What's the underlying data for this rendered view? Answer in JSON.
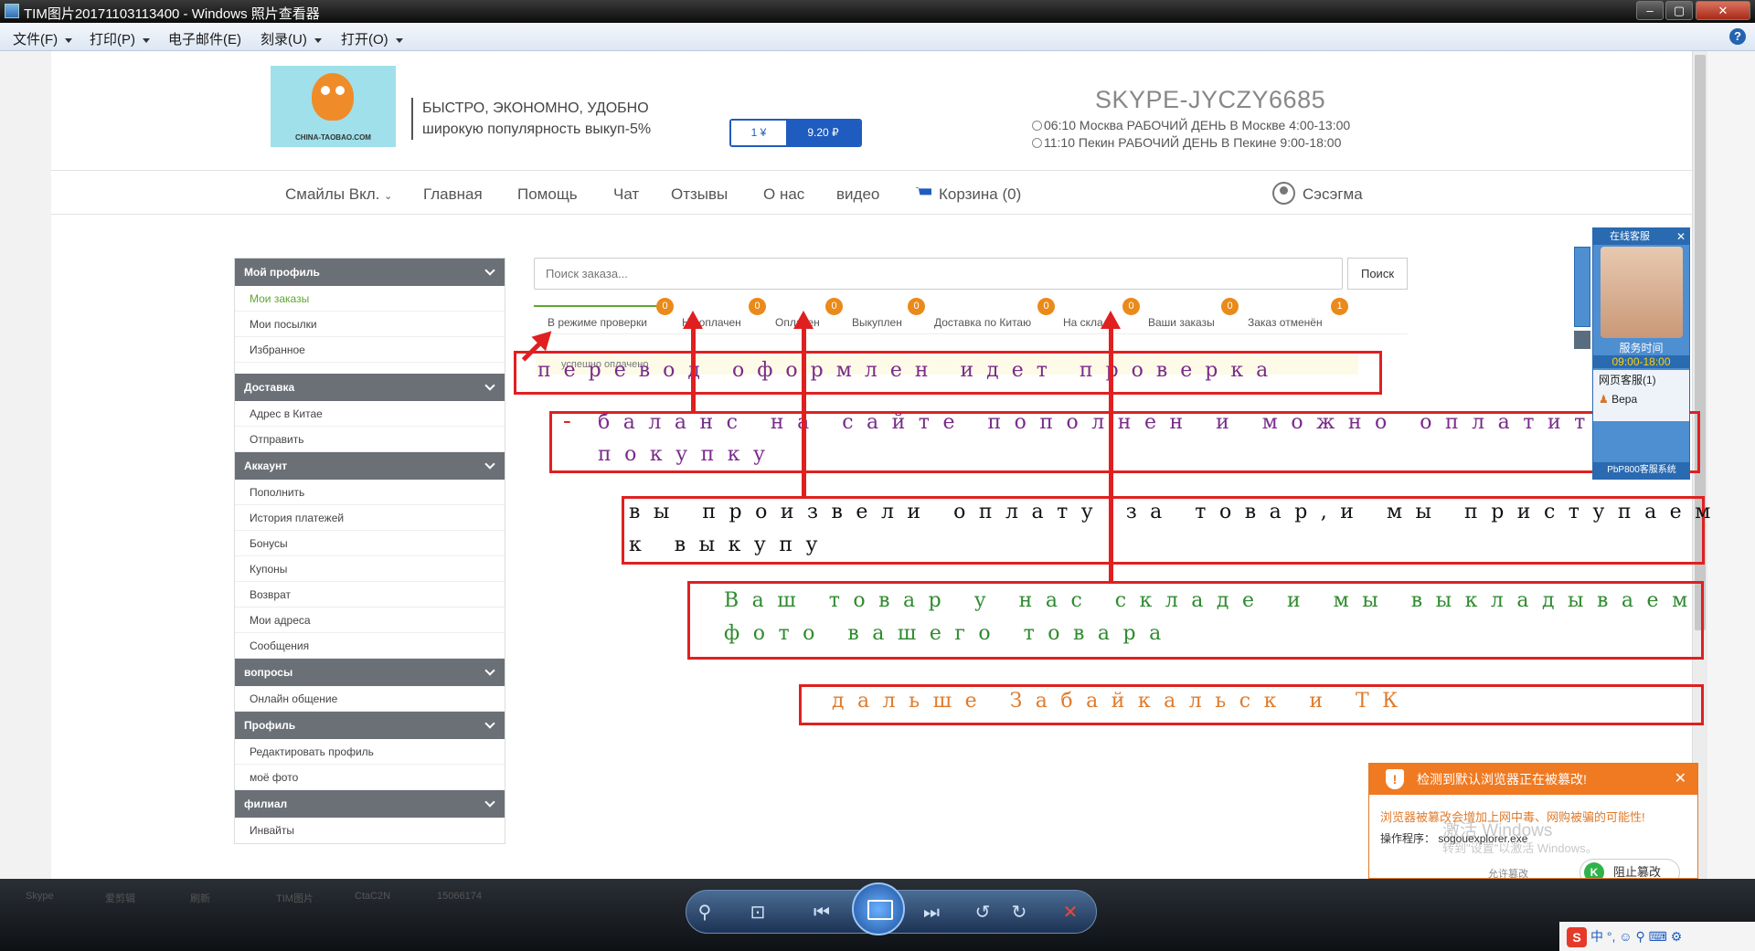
{
  "window": {
    "title": "TIM图片20171103113400 - Windows 照片查看器",
    "menu": [
      "文件(F)",
      "打印(P)",
      "电子邮件(E)",
      "刻录(U)",
      "打开(O)"
    ],
    "help": "?"
  },
  "header": {
    "logo_text": "CHINA-TAOBAO.COM",
    "slogan_line1": "БЫСТРО, ЭКОНОМНО, УДОБНО",
    "slogan_line2": "широкую популярность выкуп-5%",
    "rate_left": "1 ¥",
    "rate_right": "9.20 ₽",
    "skype": "SKYPE-JYCZY6685",
    "moscow_line": "06:10  Москва  РАБОЧИЙ ДЕНЬ В Москве 4:00-13:00",
    "beijing_line": "11:10  Пекин   РАБОЧИЙ ДЕНЬ В Пекине 9:00-18:00"
  },
  "nav": {
    "items": [
      "Смайлы Вкл.",
      "Главная",
      "Помощь",
      "Чат",
      "Отзывы",
      "О нас",
      "видео"
    ],
    "cart": "Корзина (0)",
    "user": "Сэсэгма"
  },
  "sidebar": {
    "sections": [
      {
        "title": "Мой профиль",
        "items": [
          "Мои заказы",
          "Мои посылки",
          "Избранное"
        ]
      },
      {
        "title": "Доставка",
        "items": [
          "Адрес в Китае",
          "Отправить"
        ]
      },
      {
        "title": "Аккаунт",
        "items": [
          "Пополнить",
          "История платежей",
          "Бонусы",
          "Купоны",
          "Возврат",
          "Мои адреса",
          "Сообщения"
        ]
      },
      {
        "title": "вопросы",
        "items": [
          "Онлайн общение"
        ]
      },
      {
        "title": "Профиль",
        "items": [
          "Редактировать профиль",
          "моё фото"
        ]
      },
      {
        "title": "филиал",
        "items": [
          "Инвайты"
        ]
      }
    ]
  },
  "orders": {
    "search_placeholder": "Поиск заказа...",
    "search_button": "Поиск",
    "tabs": [
      {
        "label": "В режиме проверки",
        "count": "0"
      },
      {
        "label": "Не оплачен",
        "count": "0"
      },
      {
        "label": "Оплачен",
        "count": "0"
      },
      {
        "label": "Выкуплен",
        "count": "0"
      },
      {
        "label": "Доставка по Китаю",
        "count": "0"
      },
      {
        "label": "На складе",
        "count": "0"
      },
      {
        "label": "Ваши заказы",
        "count": "0"
      },
      {
        "label": "Заказ отменён",
        "count": "1"
      }
    ],
    "notice": "успешно оплачено"
  },
  "annotations": {
    "a1": "перевод оформлен идет проверка",
    "a2_line1": "баланс на сайте пополнен и можно оплатить",
    "a2_line2": "покупку",
    "a3_line1": "вы произвели оплату за товар,и мы приступаем",
    "a3_line2": "к выкупу",
    "a4_line1": "Ваш товар у нас складе и мы выкладываем",
    "a4_line2": "фото вашего товара",
    "a5": "дальше Забайкальск и ТК",
    "colors": {
      "box": "#e02020",
      "purple": "#7a2a8a",
      "black": "#111111",
      "green": "#2e8b2e",
      "orange": "#e07a2a"
    }
  },
  "chat_widget": {
    "title": "在线客服",
    "service_time_label": "服务时间",
    "hours": "09:00-18:00",
    "group": "网页客服(1)",
    "agent": "Вера",
    "footer": "PbP800客服系统"
  },
  "warning": {
    "title": "检测到默认浏览器正在被篡改!",
    "line1": "浏览器被篡改会增加上网中毒、网购被骗的可能性!",
    "program": "操作程序： sogouexplorer.exe",
    "watermark1": "激活 Windows",
    "watermark2": "转到\"设置\"以激活 Windows。",
    "skip": "允许篡改",
    "button": "阻止篡改"
  },
  "taskbar": {
    "items": [
      "Skype",
      "爱剪辑",
      "刷新",
      "TIM图片",
      "CtaC2N",
      "15066174"
    ],
    "tray": "中 °, ☺ ⚲ ⌨ ⚙"
  }
}
